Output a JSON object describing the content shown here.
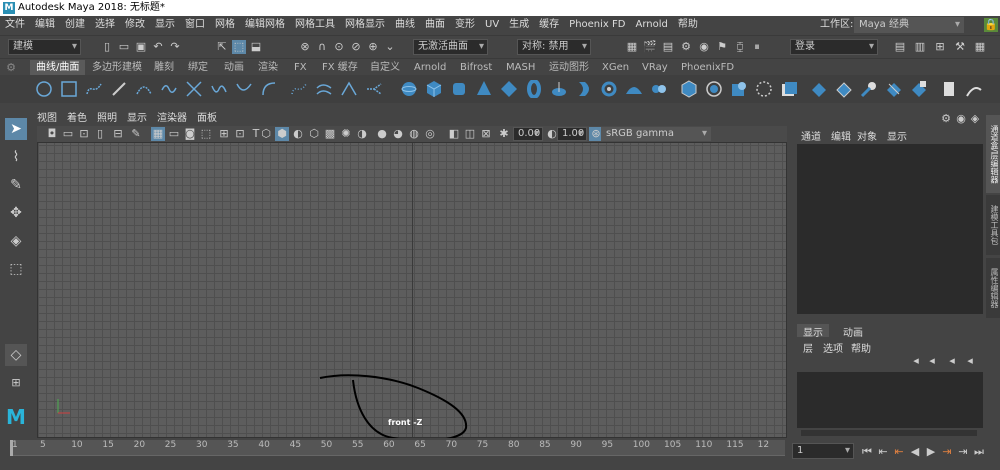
{
  "window": {
    "title": "Autodesk Maya 2018: 无标题*"
  },
  "menubar": {
    "items": [
      "文件",
      "编辑",
      "创建",
      "选择",
      "修改",
      "显示",
      "窗口",
      "网格",
      "编辑网格",
      "网格工具",
      "网格显示",
      "曲线",
      "曲面",
      "变形",
      "UV",
      "生成",
      "缓存",
      "Phoenix FD",
      "Arnold",
      "帮助"
    ],
    "workspace_label": "工作区:",
    "workspace_value": "Maya 经典"
  },
  "statusline": {
    "mode": "建模",
    "live_surface": "无激活曲面",
    "symmetry": "对称: 禁用",
    "login": "登录"
  },
  "shelf": {
    "tabs": [
      "曲线/曲面",
      "多边形建模",
      "雕刻",
      "绑定",
      "动画",
      "渲染",
      "FX",
      "FX 缓存",
      "自定义",
      "Arnold",
      "Bifrost",
      "MASH",
      "运动图形",
      "XGen",
      "VRay",
      "PhoenixFD"
    ],
    "active": "曲线/曲面"
  },
  "viewport": {
    "menu": [
      "视图",
      "着色",
      "照明",
      "显示",
      "渲染器",
      "面板"
    ],
    "camera_label": "front -Z",
    "exposure": "0.00",
    "gamma": "1.00",
    "color_space": "sRGB gamma"
  },
  "channelbox": {
    "tabs": [
      "通道",
      "编辑",
      "对象",
      "显示"
    ],
    "side_tabs": [
      "通道盒/层编辑器",
      "建模工具包",
      "属性编辑器"
    ]
  },
  "layers": {
    "tabs": [
      "显示",
      "动画"
    ],
    "menu": [
      "层",
      "选项",
      "帮助"
    ]
  },
  "timeline": {
    "ticks": [
      "5",
      "10",
      "15",
      "20",
      "25",
      "30",
      "35",
      "40",
      "45",
      "50",
      "55",
      "60",
      "65",
      "70",
      "75",
      "80",
      "85",
      "90",
      "95",
      "100",
      "105",
      "110",
      "115",
      "12"
    ],
    "start": "1",
    "current": "1"
  },
  "accent": "#5d88a8"
}
